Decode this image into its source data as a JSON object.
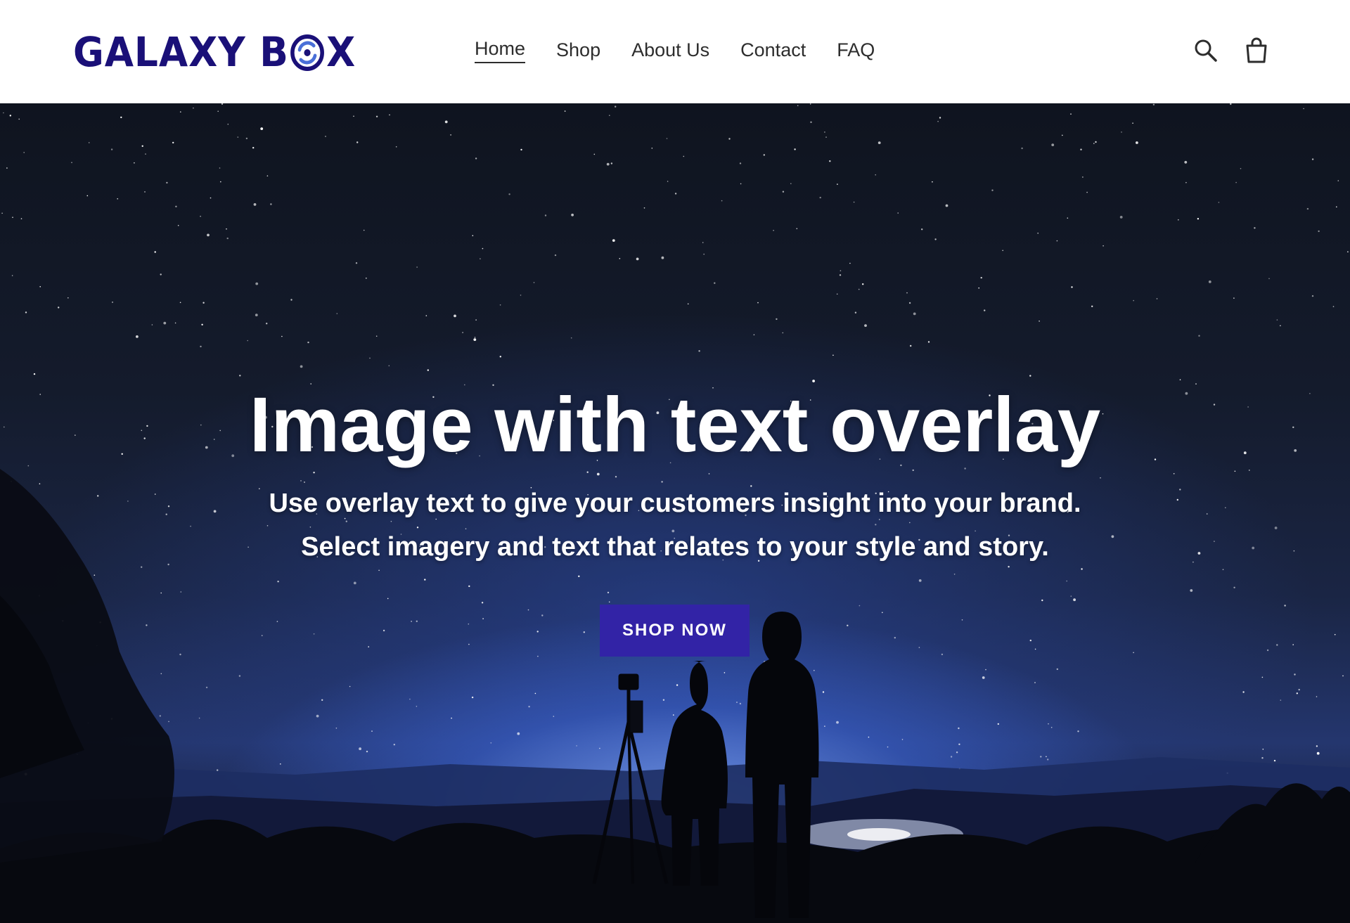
{
  "brand": {
    "name_part1": "GALAXY B",
    "name_part2": "X",
    "logo_icon": "swirl-galaxy-icon",
    "color": "#1a1078"
  },
  "nav": {
    "items": [
      {
        "label": "Home",
        "active": true
      },
      {
        "label": "Shop",
        "active": false
      },
      {
        "label": "About Us",
        "active": false
      },
      {
        "label": "Contact",
        "active": false
      },
      {
        "label": "FAQ",
        "active": false
      }
    ]
  },
  "header_icons": {
    "search": "search-icon",
    "cart": "shopping-bag-icon"
  },
  "hero": {
    "title": "Image with text overlay",
    "subtitle_line1": "Use overlay text to give your customers insight into your brand.",
    "subtitle_line2": "Select imagery and text that relates to your style and story.",
    "button_label": "SHOP NOW",
    "button_color": "#3223a6",
    "scene": "night-sky-stargazers-image"
  }
}
